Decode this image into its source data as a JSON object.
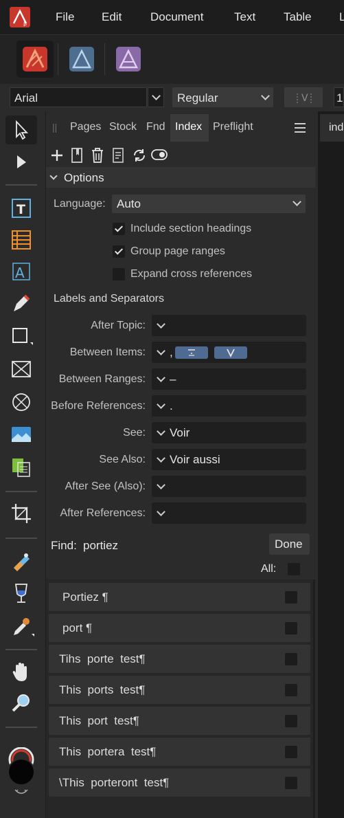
{
  "menubar": {
    "items": [
      "File",
      "Edit",
      "Document",
      "Text",
      "Table",
      "L"
    ]
  },
  "context": {
    "font_family": "Arial",
    "font_style": "Regular",
    "size_partial": "1"
  },
  "studio": {
    "tabs": [
      "Pages",
      "Stock",
      "Fnd",
      "Index",
      "Preflight"
    ],
    "doc_tab": "ind",
    "options_title": "Options",
    "language_label": "Language:",
    "language_value": "Auto",
    "checkboxes": [
      {
        "label": "Include section headings",
        "checked": true
      },
      {
        "label": "Group page ranges",
        "checked": true
      },
      {
        "label": "Expand cross references",
        "checked": false
      }
    ],
    "labels_title": "Labels and Separators",
    "separators": [
      {
        "label": "After Topic:",
        "value": ""
      },
      {
        "label": "Between Items:",
        "value": ","
      },
      {
        "label": "Between Ranges:",
        "value": "–"
      },
      {
        "label": "Before References:",
        "value": "."
      },
      {
        "label": "See:",
        "value": "Voir"
      },
      {
        "label": "See Also:",
        "value": "Voir aussi"
      },
      {
        "label": "After See (Also):",
        "value": ""
      },
      {
        "label": "After References:",
        "value": ""
      }
    ],
    "find_label": "Find:",
    "find_value": "portiez",
    "done_label": "Done",
    "all_label": "All:",
    "results": [
      "Portiez ¶",
      "port ¶",
      "Tihs  porte  test¶",
      "This  ports  test¶",
      "This  port  test¶",
      "This  portera  test¶",
      "\\This  porteront  test¶"
    ]
  },
  "colors": {
    "accent_red": "#c8362c",
    "designer_blue": "#4d6e8f",
    "photo_purple": "#8a6aa6",
    "token_blue": "#4f6b92"
  }
}
